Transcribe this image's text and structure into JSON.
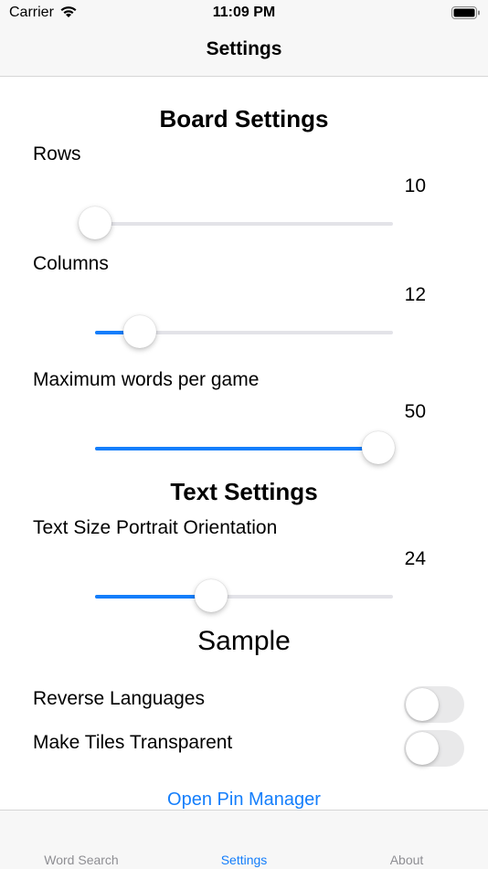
{
  "status_bar": {
    "carrier": "Carrier",
    "time": "11:09 PM"
  },
  "nav": {
    "title": "Settings"
  },
  "board_settings": {
    "title": "Board Settings",
    "rows": {
      "label": "Rows",
      "value": "10",
      "fraction": 0.0
    },
    "columns": {
      "label": "Columns",
      "value": "12",
      "fraction": 0.15
    },
    "max_words": {
      "label": "Maximum words per game",
      "value": "50",
      "fraction": 0.95
    }
  },
  "text_settings": {
    "title": "Text Settings",
    "text_size": {
      "label": "Text Size Portrait Orientation",
      "value": "24",
      "fraction": 0.39
    },
    "sample": "Sample"
  },
  "toggles": {
    "reverse_languages": {
      "label": "Reverse Languages",
      "on": false
    },
    "transparent_tiles": {
      "label": "Make Tiles Transparent",
      "on": false
    }
  },
  "open_pin_manager": "Open Pin Manager",
  "tabs": [
    {
      "label": "Word Search",
      "active": false
    },
    {
      "label": "Settings",
      "active": true
    },
    {
      "label": "About",
      "active": false
    }
  ],
  "colors": {
    "accent": "#147efb",
    "track": "#e3e3e8",
    "toggle_off": "#e9e9ea"
  }
}
